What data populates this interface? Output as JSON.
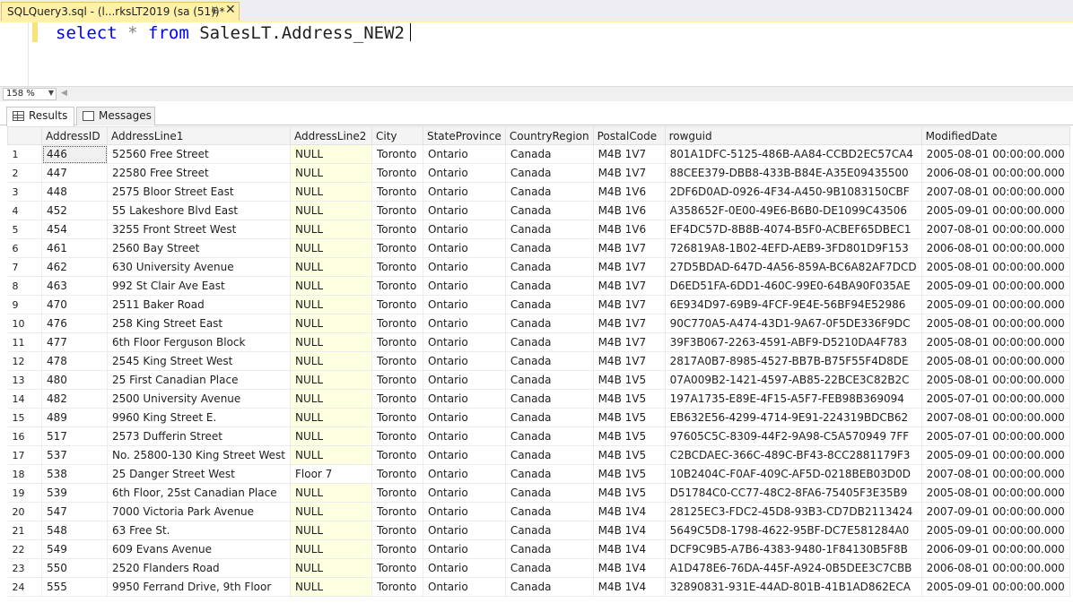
{
  "doc_tab": {
    "title": "SQLQuery3.sql - (l...rksLT2019 (sa (51))*",
    "pin": "⊕",
    "close": "✕"
  },
  "editor": {
    "kw_select": "select",
    "op_star": "*",
    "kw_from": "from",
    "object": "SalesLT.Address_NEW2"
  },
  "zoom": {
    "value": "158 %"
  },
  "results_tabs": [
    {
      "label": "Results"
    },
    {
      "label": "Messages"
    }
  ],
  "grid": {
    "columns": [
      "",
      "AddressID",
      "AddressLine1",
      "AddressLine2",
      "City",
      "StateProvince",
      "CountryRegion",
      "PostalCode",
      "rowguid",
      "ModifiedDate"
    ],
    "rows": [
      [
        "1",
        "446",
        "52560 Free Street",
        "NULL",
        "Toronto",
        "Ontario",
        "Canada",
        "M4B 1V7",
        "801A1DFC-5125-486B-AA84-CCBD2EC57CA4",
        "2005-08-01 00:00:00.000"
      ],
      [
        "2",
        "447",
        "22580 Free Street",
        "NULL",
        "Toronto",
        "Ontario",
        "Canada",
        "M4B 1V7",
        "88CEE379-DBB8-433B-B84E-A35E09435500",
        "2006-08-01 00:00:00.000"
      ],
      [
        "3",
        "448",
        "2575 Bloor Street East",
        "NULL",
        "Toronto",
        "Ontario",
        "Canada",
        "M4B 1V6",
        "2DF6D0AD-0926-4F34-A450-9B1083150CBF",
        "2007-08-01 00:00:00.000"
      ],
      [
        "4",
        "452",
        "55 Lakeshore Blvd East",
        "NULL",
        "Toronto",
        "Ontario",
        "Canada",
        "M4B 1V6",
        "A358652F-0E00-49E6-B6B0-DE1099C43506",
        "2005-09-01 00:00:00.000"
      ],
      [
        "5",
        "454",
        "3255 Front Street West",
        "NULL",
        "Toronto",
        "Ontario",
        "Canada",
        "M4B 1V6",
        "EF4DC57D-8B8B-4074-B5F0-ACBEF65DBEC1",
        "2007-08-01 00:00:00.000"
      ],
      [
        "6",
        "461",
        "2560 Bay Street",
        "NULL",
        "Toronto",
        "Ontario",
        "Canada",
        "M4B 1V7",
        "726819A8-1B02-4EFD-AEB9-3FD801D9F153",
        "2006-08-01 00:00:00.000"
      ],
      [
        "7",
        "462",
        "630 University Avenue",
        "NULL",
        "Toronto",
        "Ontario",
        "Canada",
        "M4B 1V7",
        "27D5BDAD-647D-4A56-859A-BC6A82AF7DCD",
        "2005-08-01 00:00:00.000"
      ],
      [
        "8",
        "463",
        "992 St Clair Ave East",
        "NULL",
        "Toronto",
        "Ontario",
        "Canada",
        "M4B 1V7",
        "D6ED51FA-6DD1-460C-99E0-64BA90F035AE",
        "2005-09-01 00:00:00.000"
      ],
      [
        "9",
        "470",
        "2511 Baker Road",
        "NULL",
        "Toronto",
        "Ontario",
        "Canada",
        "M4B 1V7",
        "6E934D97-69B9-4FCF-9E4E-56BF94E52986",
        "2005-09-01 00:00:00.000"
      ],
      [
        "10",
        "476",
        "258 King Street East",
        "NULL",
        "Toronto",
        "Ontario",
        "Canada",
        "M4B 1V7",
        "90C770A5-A474-43D1-9A67-0F5DE336F9DC",
        "2005-08-01 00:00:00.000"
      ],
      [
        "11",
        "477",
        "6th Floor Ferguson Block",
        "NULL",
        "Toronto",
        "Ontario",
        "Canada",
        "M4B 1V7",
        "39F3B067-2263-4591-ABF9-D5210DA4F783",
        "2005-08-01 00:00:00.000"
      ],
      [
        "12",
        "478",
        "2545 King Street West",
        "NULL",
        "Toronto",
        "Ontario",
        "Canada",
        "M4B 1V7",
        "2817A0B7-8985-4527-BB7B-B75F55F4D8DE",
        "2005-08-01 00:00:00.000"
      ],
      [
        "13",
        "480",
        "25 First Canadian Place",
        "NULL",
        "Toronto",
        "Ontario",
        "Canada",
        "M4B 1V5",
        "07A009B2-1421-4597-AB85-22BCE3C82B2C",
        "2005-08-01 00:00:00.000"
      ],
      [
        "14",
        "482",
        "2500 University Avenue",
        "NULL",
        "Toronto",
        "Ontario",
        "Canada",
        "M4B 1V5",
        "197A1735-E89E-4F15-A5F7-FEB98B369094",
        "2005-07-01 00:00:00.000"
      ],
      [
        "15",
        "489",
        "9960 King Street E.",
        "NULL",
        "Toronto",
        "Ontario",
        "Canada",
        "M4B 1V5",
        "EB632E56-4299-4714-9E91-224319BDCB62",
        "2007-08-01 00:00:00.000"
      ],
      [
        "16",
        "517",
        "2573 Dufferin Street",
        "NULL",
        "Toronto",
        "Ontario",
        "Canada",
        "M4B 1V5",
        "97605C5C-8309-44F2-9A98-C5A570949 7FF",
        "2005-07-01 00:00:00.000"
      ],
      [
        "17",
        "537",
        "No. 25800-130 King Street West",
        "NULL",
        "Toronto",
        "Ontario",
        "Canada",
        "M4B 1V5",
        "C2BCDAEC-366C-489C-BF43-8CC2881179F3",
        "2005-09-01 00:00:00.000"
      ],
      [
        "18",
        "538",
        "25 Danger Street West",
        "Floor 7",
        "Toronto",
        "Ontario",
        "Canada",
        "M4B 1V5",
        "10B2404C-F0AF-409C-AF5D-0218BEB03D0D",
        "2007-08-01 00:00:00.000"
      ],
      [
        "19",
        "539",
        "6th Floor, 25st Canadian Place",
        "NULL",
        "Toronto",
        "Ontario",
        "Canada",
        "M4B 1V5",
        "D51784C0-CC77-48C2-8FA6-75405F3E35B9",
        "2005-08-01 00:00:00.000"
      ],
      [
        "20",
        "547",
        "7000 Victoria Park Avenue",
        "NULL",
        "Toronto",
        "Ontario",
        "Canada",
        "M4B 1V4",
        "28125EC3-FDC2-45D8-93B3-CD7DB2113424",
        "2007-09-01 00:00:00.000"
      ],
      [
        "21",
        "548",
        "63 Free St.",
        "NULL",
        "Toronto",
        "Ontario",
        "Canada",
        "M4B 1V4",
        "5649C5D8-1798-4622-95BF-DC7E581284A0",
        "2005-09-01 00:00:00.000"
      ],
      [
        "22",
        "549",
        "609 Evans Avenue",
        "NULL",
        "Toronto",
        "Ontario",
        "Canada",
        "M4B 1V4",
        "DCF9C9B5-A7B6-4383-9480-1F84130B5F8B",
        "2006-09-01 00:00:00.000"
      ],
      [
        "23",
        "550",
        "2520 Flanders Road",
        "NULL",
        "Toronto",
        "Ontario",
        "Canada",
        "M4B 1V4",
        "A1D478E6-76DA-445F-A924-0B5DEE3C7CBB",
        "2006-08-01 00:00:00.000"
      ],
      [
        "24",
        "555",
        "9950 Ferrand Drive, 9th Floor",
        "NULL",
        "Toronto",
        "Ontario",
        "Canada",
        "M4B 1V4",
        "32890831-931E-44AD-801B-41B1AD862ECA",
        "2005-09-01 00:00:00.000"
      ]
    ]
  }
}
